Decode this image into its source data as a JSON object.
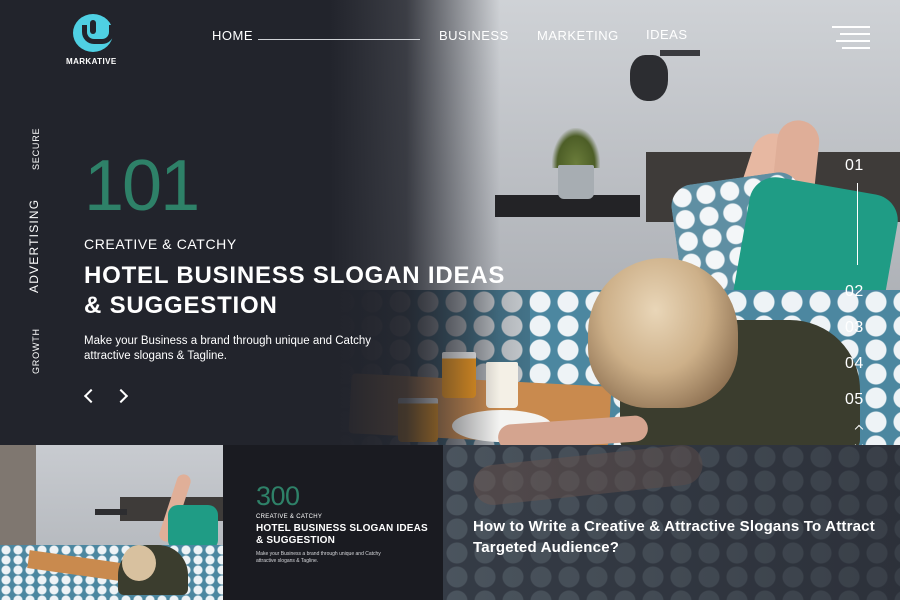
{
  "brand": {
    "name": "MARKATIVE",
    "logo_icon": "markative-logo",
    "accent_color": "#4fd0e3",
    "number_color": "#2e8168"
  },
  "nav": {
    "items": [
      {
        "label": "HOME",
        "active": true
      },
      {
        "label": "BUSINESS"
      },
      {
        "label": "MARKETING"
      },
      {
        "label": "IDEAS"
      }
    ],
    "menu_icon": "hamburger-menu-icon"
  },
  "side_labels": [
    "SECURE",
    "ADVERTISING",
    "GROWTH"
  ],
  "hero": {
    "number": "101",
    "eyebrow": "CREATIVE & CATCHY",
    "headline": "HOTEL BUSINESS SLOGAN IDEAS & SUGGESTION",
    "subtext": "Make your Business a brand through unique and Catchy attractive slogans & Tagline.",
    "prev_icon": "chevron-left-icon",
    "next_icon": "chevron-right-icon"
  },
  "slides": {
    "numbers": [
      "01",
      "02",
      "03",
      "04",
      "05"
    ],
    "active": "01",
    "up_icon": "chevron-up-icon",
    "down_icon": "chevron-down-icon"
  },
  "card": {
    "number": "300",
    "eyebrow": "CREATIVE & CATCHY",
    "headline": "HOTEL BUSINESS SLOGAN IDEAS & SUGGESTION",
    "subtext": "Make your Business a brand through unique and Catchy attractive slogans & Tagline."
  },
  "article": {
    "title": "How to Write a Creative & Attractive Slogans To Attract Targeted Audience?"
  }
}
